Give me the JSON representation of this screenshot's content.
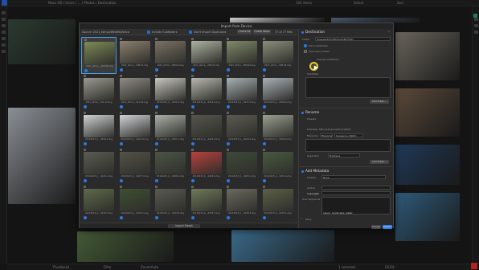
{
  "app": {
    "path_text": "Macs HD / Users / ... / Photos / Destination",
    "top_right_labels": [
      "100 items",
      "Select",
      "Sort"
    ],
    "bottom_labels": [
      "Thumbnail",
      "Filter",
      "Zoom/Auto",
      "1 selected",
      "Fill/Fit"
    ]
  },
  "dialog": {
    "title": "Import from Device",
    "toolbar": {
      "source_label": "Source: 2021_Kenya/Wildlife/Africa",
      "include_subfolders_label": "Include Subfolders",
      "dont_import_duplicates_label": "Don't Import Duplicates",
      "check_all_label": "Check All",
      "check_none_label": "Check None",
      "count_label": "77 of 77 files"
    },
    "photos": [
      {
        "name": "2021_Africa_..002150.dng",
        "checked": true,
        "selected": true,
        "color": "#7d8b56"
      },
      {
        "name": "2021_Africa_..008.01.dng",
        "checked": true,
        "selected": false,
        "color": "#8c8070"
      },
      {
        "name": "2021_Africa_..008.02.dng",
        "checked": true,
        "selected": false,
        "color": "#7a7264"
      },
      {
        "name": "2021_Africa_..008.03.dng",
        "checked": true,
        "selected": false,
        "color": "#aeb3a2"
      },
      {
        "name": "2021_Africa_..008.04.dng",
        "checked": true,
        "selected": false,
        "color": "#7f8a6a"
      },
      {
        "name": "2021_Africa_..008.05.dng",
        "checked": true,
        "selected": false,
        "color": "#8a8f7a"
      },
      {
        "name": "2021_Africa_..011.10.dng",
        "checked": true,
        "selected": false,
        "color": "#9a9a90"
      },
      {
        "name": "2021_Africa_..011.50.dng",
        "checked": true,
        "selected": false,
        "color": "#8f8a84"
      },
      {
        "name": "20110215_b_..0216.3.dng",
        "checked": true,
        "selected": false,
        "color": "#c7c6bf"
      },
      {
        "name": "20110215_b_..0216.4.dng",
        "checked": true,
        "selected": false,
        "color": "#b8b8b0"
      },
      {
        "name": "20110215_b_..0217.5.dng",
        "checked": true,
        "selected": false,
        "color": "#a7b0b4"
      },
      {
        "name": "20110215_b_..0218.6.dng",
        "checked": true,
        "selected": false,
        "color": "#a9b2b8"
      },
      {
        "name": "20110215_b_..0220.2.dng",
        "checked": true,
        "selected": false,
        "color": "#cfd3d4"
      },
      {
        "name": "20110215_b_..0221.8.dng",
        "checked": true,
        "selected": false,
        "color": "#d0d4d6"
      },
      {
        "name": "20110215_b_..0222.7.dng",
        "checked": true,
        "selected": false,
        "color": "#aab0a8"
      },
      {
        "name": "20110215_b_..0223.4.dng",
        "checked": true,
        "selected": false,
        "color": "#56564e"
      },
      {
        "name": "20110215_b_..0224.2.dng",
        "checked": true,
        "selected": false,
        "color": "#5c5a52"
      },
      {
        "name": "20110215_b_..0225.8.dng",
        "checked": true,
        "selected": false,
        "color": "#9aa090"
      },
      {
        "name": "20110215_b_..0226.1.dng",
        "checked": true,
        "selected": false,
        "color": "#5a5b52"
      },
      {
        "name": "20110215_b_..0227.3.dng",
        "checked": true,
        "selected": false,
        "color": "#545348"
      },
      {
        "name": "20110215_b_..0228.4.dng",
        "checked": true,
        "selected": false,
        "color": "#4c5546"
      },
      {
        "name": "20110215_b_..0229.6.dng",
        "checked": true,
        "selected": false,
        "color": "#b9413e"
      },
      {
        "name": "20110215_b_..0230.1.dng",
        "checked": true,
        "selected": false,
        "color": "#3f4a3a"
      },
      {
        "name": "20110215_b_..0231.4.dng",
        "checked": true,
        "selected": false,
        "color": "#495a3f"
      },
      {
        "name": "20110215_b_..0232.5.dng",
        "checked": true,
        "selected": false,
        "color": "#5e6a4a"
      },
      {
        "name": "20110215_b_..0233.2.dng",
        "checked": true,
        "selected": false,
        "color": "#3d5033"
      },
      {
        "name": "20110215_b_..0234.9.dng",
        "checked": true,
        "selected": false,
        "color": "#5a5a52"
      },
      {
        "name": "20110215_b_..0235.7.dng",
        "checked": true,
        "selected": false,
        "color": "#6f7a5a"
      },
      {
        "name": "20110215_b_..0236.3.dng",
        "checked": true,
        "selected": false,
        "color": "#6c6a60"
      },
      {
        "name": "20110215_b_..0237.1.dng",
        "checked": true,
        "selected": false,
        "color": "#5c6048"
      }
    ],
    "import_preset_label": "Import Preset",
    "destination": {
      "title": "Destination",
      "folder_label": "Folder",
      "folder_value": "/Users/admin/Pictures/Portfolio",
      "put_in_subfolder_label": "Put in Subfolder",
      "secondary_folder_label": "Secondary Folder",
      "include_subfolders_label": "Include Subfolders",
      "subfolder_label": "Subfolder",
      "add_token_label": "Add Token..."
    },
    "rename": {
      "title": "Rename",
      "preset_label": "Presets",
      "example_label": "Example: Mihuanbetorne8marz0001",
      "filename_label": "Filename",
      "sequence_label": "Sequence (0001)",
      "separator_label": "Separator",
      "separator_value": "Hyphens",
      "add_token_label": "Add Token..."
    },
    "metadata": {
      "title": "Add Metadata",
      "preset_label": "Presets",
      "preset_value": "None",
      "author_label": "Author",
      "copyright_label": "Copyright",
      "user_keywords_label": "User Keywords",
      "keywords_value": "canon, landscape, water"
    },
    "more_label": "More",
    "cancel_label": "Cancel",
    "import_label": "Import"
  },
  "background": {
    "tiles": [
      {
        "color": "#2a3a2f"
      },
      {
        "color": "#8a8f96"
      },
      {
        "color": "#d6d8db"
      },
      {
        "color": "#4a5d70"
      },
      {
        "color": "#6b665c"
      },
      {
        "color": "#5c4a3a"
      },
      {
        "color": "#1f3a5a"
      },
      {
        "color": "#3a6a8a"
      },
      {
        "color": "#445a36"
      },
      {
        "color": "#2e5a7a"
      }
    ]
  },
  "accent_color": "#2c7be5",
  "cursor_highlight_color": "#e8c83a"
}
